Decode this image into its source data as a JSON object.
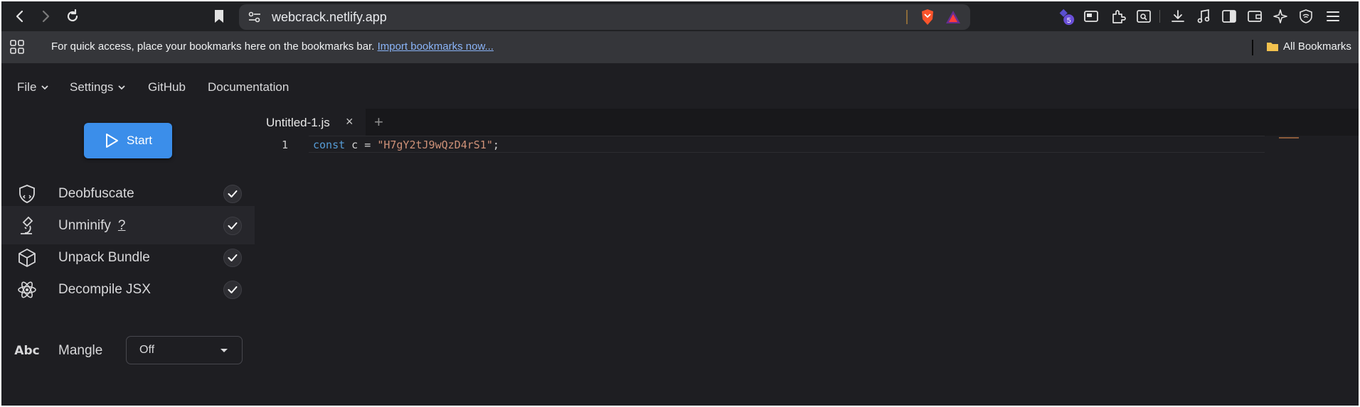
{
  "browser": {
    "url": "webcrack.netlify.app",
    "extensions_badge": "5",
    "bookmarks_prompt": "For quick access, place your bookmarks here on the bookmarks bar.",
    "import_link": "Import bookmarks now...",
    "all_bookmarks": "All Bookmarks"
  },
  "menu": {
    "file": "File",
    "settings": "Settings",
    "github": "GitHub",
    "documentation": "Documentation"
  },
  "sidebar": {
    "start_label": "Start",
    "options": [
      {
        "label": "Deobfuscate",
        "checked": true,
        "icon": "shield-code-icon"
      },
      {
        "label": "Unminify",
        "help": "?",
        "checked": true,
        "icon": "microscope-icon"
      },
      {
        "label": "Unpack Bundle",
        "checked": true,
        "icon": "package-icon"
      },
      {
        "label": "Decompile JSX",
        "checked": true,
        "icon": "react-atom-icon"
      }
    ],
    "mangle": {
      "label": "Mangle",
      "icon_text": "Abc",
      "value": "Off"
    }
  },
  "editor": {
    "tab_name": "Untitled-1.js",
    "tab_close": "×",
    "tab_add": "+",
    "line_number": "1",
    "code": {
      "keyword": "const",
      "identifier": " c = ",
      "string": "\"H7gY2tJ9wQzD4rS1\"",
      "terminator": ";"
    }
  },
  "colors": {
    "accent": "#3b8eea",
    "keyword": "#569cd6",
    "string": "#ce9178",
    "background": "#1e1e22"
  }
}
